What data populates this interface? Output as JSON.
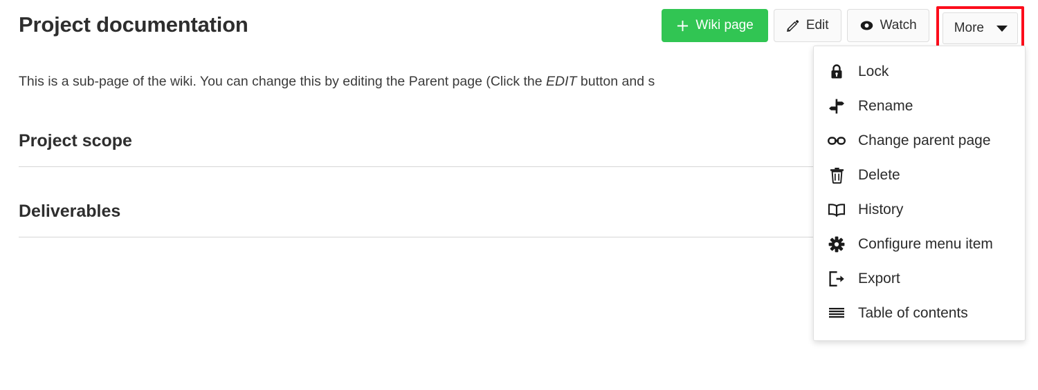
{
  "page": {
    "title": "Project documentation",
    "intro_before": "This is a sub-page of the wiki. You can change this by editing the Parent page (Click the ",
    "intro_emphasis": "EDIT",
    "intro_after": " button and s",
    "sections": [
      {
        "heading": "Project scope"
      },
      {
        "heading": "Deliverables"
      }
    ]
  },
  "toolbar": {
    "wiki_page_label": "Wiki page",
    "wiki_page_icon": "plus-icon",
    "edit_label": "Edit",
    "edit_icon": "pencil-icon",
    "watch_label": "Watch",
    "watch_icon": "eye-icon",
    "more_label": "More",
    "more_icon": "chevron-down-icon"
  },
  "more_menu": {
    "items": [
      {
        "label": "Lock",
        "icon": "lock-icon"
      },
      {
        "label": "Rename",
        "icon": "signpost-icon"
      },
      {
        "label": "Change parent page",
        "icon": "link-icon"
      },
      {
        "label": "Delete",
        "icon": "trash-icon"
      },
      {
        "label": "History",
        "icon": "book-icon"
      },
      {
        "label": "Configure menu item",
        "icon": "gear-icon"
      },
      {
        "label": "Export",
        "icon": "export-icon"
      },
      {
        "label": "Table of contents",
        "icon": "list-lines-icon"
      }
    ]
  },
  "colors": {
    "primary_button": "#31c553",
    "highlight_box": "#fc0d1b",
    "text": "#2e2e2e",
    "rule": "#d6d6d6"
  }
}
